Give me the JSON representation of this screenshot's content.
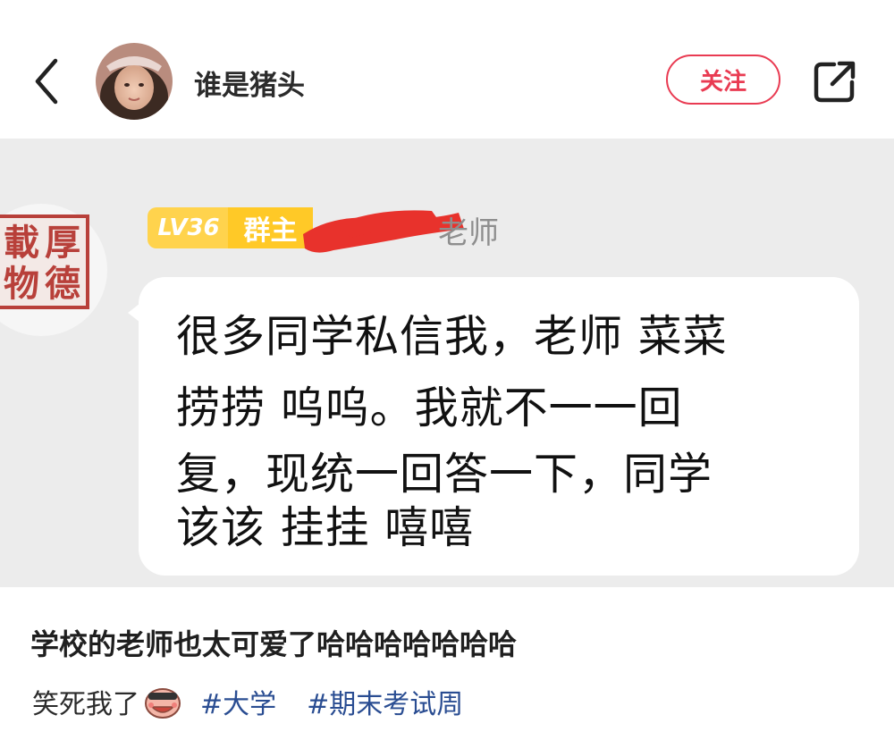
{
  "header": {
    "back_icon": "chevron-left-icon",
    "username": "谁是猪头",
    "follow_label": "关注",
    "share_icon": "share-external-icon",
    "accent_color": "#e93b52"
  },
  "post_image": {
    "seal_chars": [
      "厚",
      "德",
      "載",
      "物"
    ],
    "level_badge": "LV36",
    "role_badge": "群主",
    "sender_name_visible": "老师",
    "message_lines": [
      "很多同学私信我，老师 菜菜",
      "捞捞  呜呜。我就不一一回",
      "复，现统一回答一下，同学",
      "该该  挂挂  嘻嘻"
    ]
  },
  "caption": {
    "title": "学校的老师也太可爱了哈哈哈哈哈哈哈",
    "text": "笑死我了",
    "emoji_icon": "laughing-face-emoji-icon",
    "hashtags": [
      "#大学",
      "#期末考试周"
    ],
    "hashtag_color": "#2a4d92"
  }
}
